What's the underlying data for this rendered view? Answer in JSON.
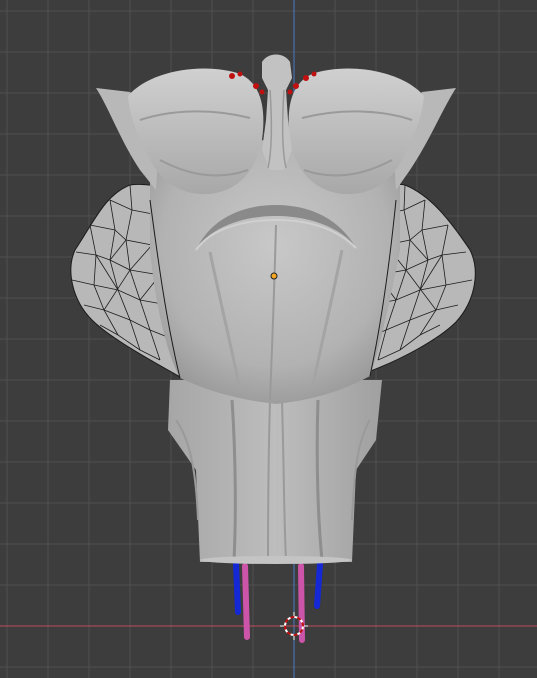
{
  "viewport": {
    "view": "front",
    "object_mode": "sculpt/mesh",
    "colors": {
      "background": "#3d3d3d",
      "grid_minor": "#474747",
      "grid_major": "#505050",
      "axis_x": "#c04a59",
      "axis_z": "#4a79c4",
      "mesh_fill": "#b6b6b6",
      "mesh_shade": "#8e8e8e",
      "mesh_highlight": "#d2d2d2",
      "wireframe": "#1c1c1c",
      "bone_pink": "#cc55aa",
      "bone_blue": "#1428d6",
      "marker_red": "#c01010",
      "origin_dot": "#f5a623"
    },
    "icons": [
      "3d-cursor-icon",
      "object-origin-icon"
    ]
  }
}
